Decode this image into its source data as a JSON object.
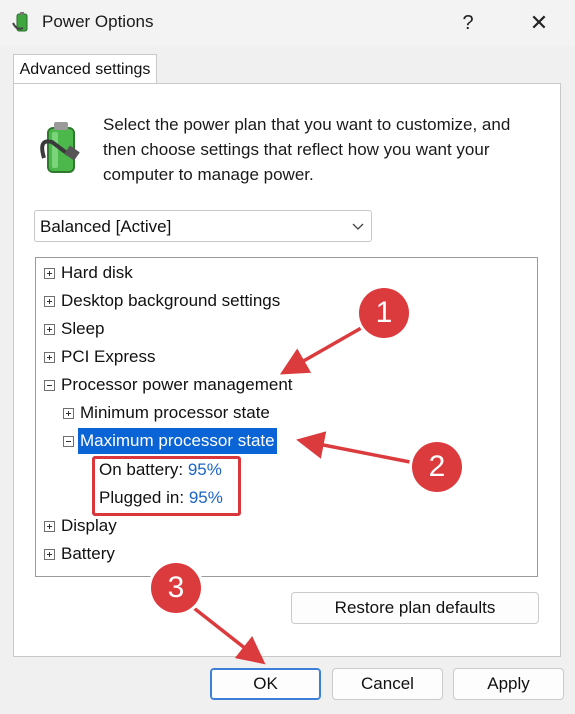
{
  "window": {
    "title": "Power Options",
    "help_label": "?",
    "close_label": "✕",
    "icon": "power-battery-icon"
  },
  "tabs": [
    {
      "label": "Advanced settings"
    }
  ],
  "intro": {
    "text": "Select the power plan that you want to customize, and then choose settings that reflect how you want your computer to manage power.",
    "icon": "power-plug-battery-icon"
  },
  "plan_select": {
    "value": "Balanced [Active]"
  },
  "tree": {
    "items": [
      {
        "label": "Hard disk",
        "expander": "plus"
      },
      {
        "label": "Desktop background settings",
        "expander": "plus"
      },
      {
        "label": "Sleep",
        "expander": "plus"
      },
      {
        "label": "PCI Express",
        "expander": "plus"
      },
      {
        "label": "Processor power management",
        "expander": "minus"
      },
      {
        "label": "Minimum processor state",
        "expander": "plus"
      },
      {
        "label": "Maximum processor state",
        "expander": "minus"
      },
      {
        "label": "Display",
        "expander": "plus"
      },
      {
        "label": "Battery",
        "expander": "plus"
      }
    ],
    "values": [
      {
        "label": "On battery:",
        "value": "95%"
      },
      {
        "label": "Plugged in:",
        "value": "95%"
      }
    ]
  },
  "buttons": {
    "restore": "Restore plan defaults",
    "ok": "OK",
    "cancel": "Cancel",
    "apply": "Apply"
  },
  "callouts": [
    "1",
    "2",
    "3"
  ],
  "colors": {
    "selection": "#0a64d6",
    "link": "#1a64c8",
    "callout": "#dc3b3e"
  }
}
